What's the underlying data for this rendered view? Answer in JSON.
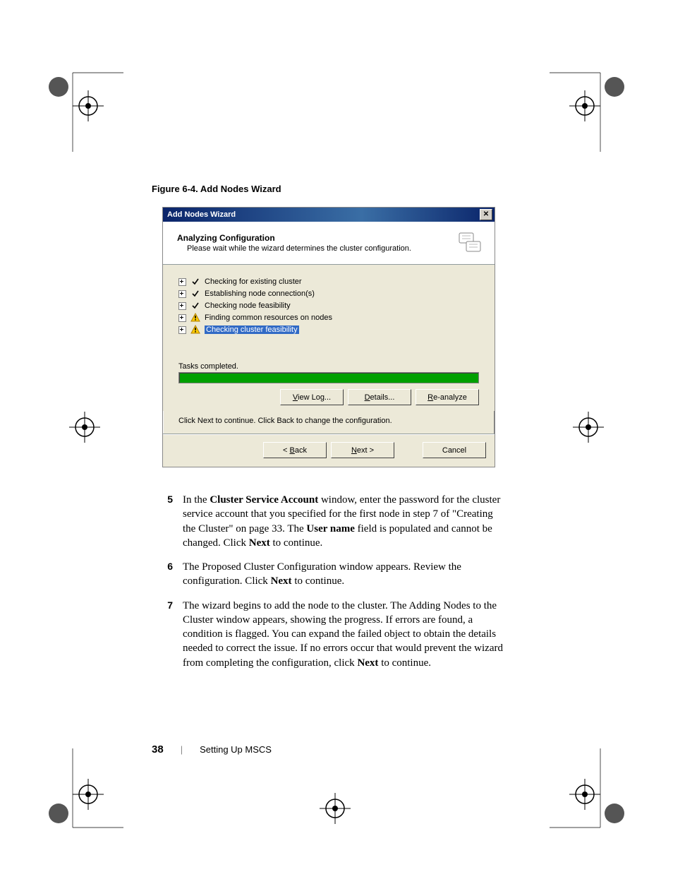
{
  "figure_caption": "Figure 6-4.    Add Nodes Wizard",
  "dialog": {
    "title": "Add Nodes Wizard",
    "header_title": "Analyzing Configuration",
    "header_sub": "Please wait while the wizard determines the cluster configuration.",
    "tasks": [
      {
        "status": "ok",
        "label": "Checking for existing cluster"
      },
      {
        "status": "ok",
        "label": "Establishing node connection(s)"
      },
      {
        "status": "ok",
        "label": "Checking node feasibility"
      },
      {
        "status": "warn",
        "label": "Finding common resources on nodes"
      },
      {
        "status": "warn",
        "label": "Checking cluster feasibility",
        "selected": true
      }
    ],
    "tasks_completed": "Tasks completed.",
    "btn_viewlog": "View Log...",
    "btn_viewlog_u": "V",
    "btn_details": "Details...",
    "btn_details_u": "D",
    "btn_reanalyze": "Re-analyze",
    "btn_reanalyze_u": "R",
    "instruction": "Click Next to continue. Click Back to change the configuration.",
    "btn_back": "< Back",
    "btn_back_u": "B",
    "btn_next": "Next >",
    "btn_next_u": "N",
    "btn_cancel": "Cancel"
  },
  "steps": {
    "s5_num": "5",
    "s5_a": "In the ",
    "s5_b": "Cluster Service Account",
    "s5_c": " window, enter the password for the cluster service account that you specified for the first node in step 7 of \"Creating the Cluster\" on page 33. The ",
    "s5_d": "User name",
    "s5_e": " field is populated and cannot be changed. Click ",
    "s5_f": "Next",
    "s5_g": " to continue.",
    "s6_num": "6",
    "s6_a": "The Proposed Cluster Configuration window appears. Review the configuration. Click ",
    "s6_b": "Next",
    "s6_c": " to continue.",
    "s7_num": "7",
    "s7_a": "The wizard begins to add the node to the cluster. The Adding Nodes to the Cluster window appears, showing the progress. If errors are found, a condition is flagged. You can expand the failed object to obtain the details needed to correct the issue. If no errors occur that would prevent the wizard from completing the configuration, click ",
    "s7_b": "Next",
    "s7_c": " to continue."
  },
  "footer": {
    "page": "38",
    "section": "Setting Up MSCS"
  }
}
